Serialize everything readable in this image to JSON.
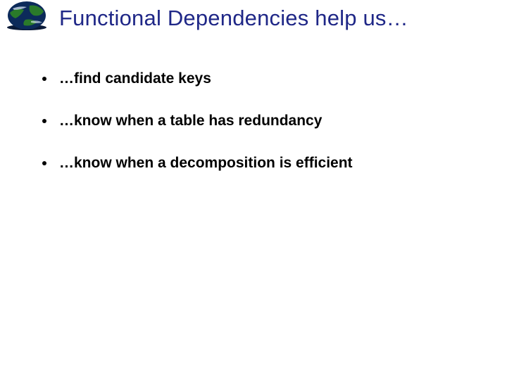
{
  "title": "Functional Dependencies help us…",
  "bullets": [
    "…find candidate keys",
    "…know when a table has redundancy",
    "…know when a decomposition is efficient"
  ],
  "logo": {
    "semantic": "globe-earth-icon",
    "colors": {
      "land": "#2a7a2a",
      "ocean": "#0c2a5a",
      "shadow": "#0a1a38",
      "cloud": "#e8f4ff"
    }
  }
}
